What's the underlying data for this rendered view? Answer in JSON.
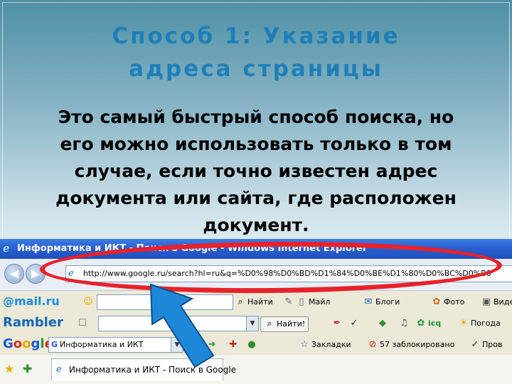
{
  "slide": {
    "title_line1": "Способ 1: Указание",
    "title_line2": "адреса страницы",
    "body_lines": [
      "Это самый быстрый способ поиска, но",
      "его можно использовать только в том",
      "случае, если точно известен адрес",
      "документа или сайта, где расположен",
      "документ."
    ]
  },
  "browser": {
    "window_title": "Информатика и ИКТ - Поиск в Google - Windows Internet Explorer",
    "address_url": "http://www.google.ru/search?hl=ru&q=%D0%98%D0%BD%D1%84%D0%BE%D1%80%D0%BC%D0%B0",
    "mailru_toolbar": {
      "logo": "@mail.ru",
      "find_label": "Найти",
      "mail_label": "Майл",
      "blogs_label": "Блоги",
      "photo_label": "Фото",
      "video_label": "Виде"
    },
    "rambler_toolbar": {
      "logo": "Rambler",
      "search_button": "Найти!",
      "icq_label": "icq",
      "weather_label": "Погода"
    },
    "google_toolbar": {
      "logo_letters": [
        "G",
        "o",
        "o",
        "g",
        "l",
        "e"
      ],
      "search_value": "Информатика и ИКТ",
      "bookmarks_label": "Закладки",
      "blocked_label": "57 заблокировано",
      "check_label": "Пров"
    },
    "tab": {
      "label": "Информатика и ИКТ - Поиск в Google"
    }
  },
  "colors": {
    "title": "#1e7fb8",
    "highlight_ring": "#e8222a",
    "arrow": "#1e88d8",
    "titlebar": "#2a5fcf"
  }
}
